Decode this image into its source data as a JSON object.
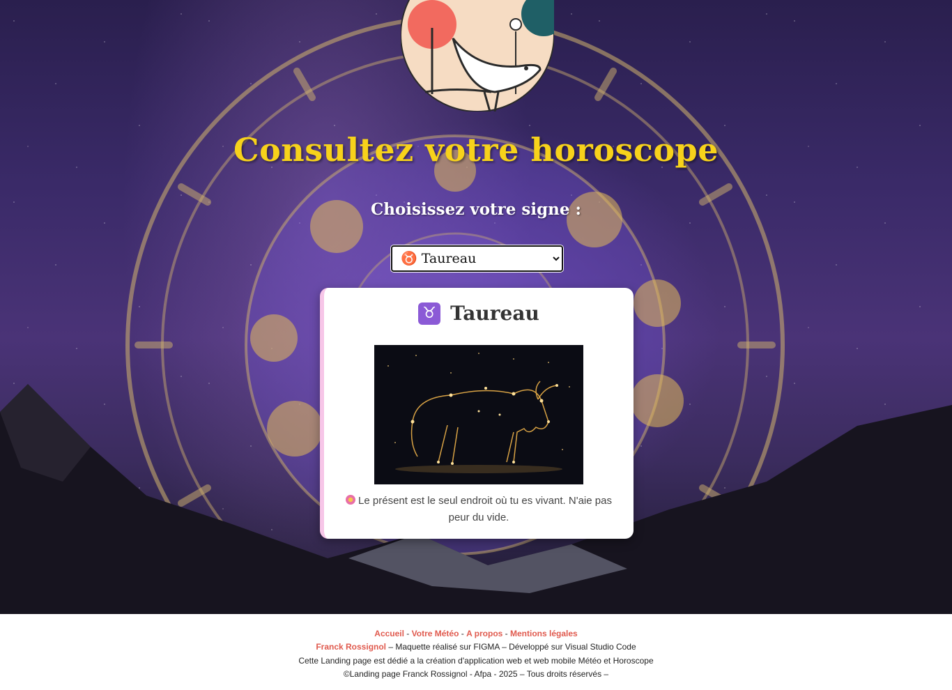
{
  "page": {
    "title": "Consultez votre horoscope",
    "subtitle": "Choisissez votre signe :"
  },
  "select": {
    "selected_label": "♉ Taureau",
    "options": [
      "♉ Taureau"
    ]
  },
  "card": {
    "symbol": "♉",
    "sign_name": "Taureau",
    "image_alt": "constellation-taureau",
    "message": "Le présent est le seul endroit où tu es vivant. N'aie pas peur du vide."
  },
  "footer": {
    "links": {
      "home": "Accueil",
      "weather": "Votre Météo",
      "about": "A propos",
      "legal": "Mentions légales"
    },
    "sep1": " - ",
    "sep2": " - ",
    "sep3": " -  ",
    "author_link": "Franck Rossignol",
    "author_rest": " – Maquette réalisé sur FIGMA – Développé sur Visual Studio Code",
    "line3": "Cette Landing page est dédié a la création d'application web et web mobile Météo et Horoscope",
    "line4": "©Landing page Franck Rossignol - Afpa - 2025 – Tous droits réservés –"
  },
  "colors": {
    "title": "#f7d21b",
    "link": "#e05a4e",
    "card_accent": "#f7c6e8",
    "badge": "#8b5ad6"
  },
  "icons": {
    "logo": "bird-tree-logo",
    "sign": "taurus-icon",
    "message": "flower-icon"
  }
}
